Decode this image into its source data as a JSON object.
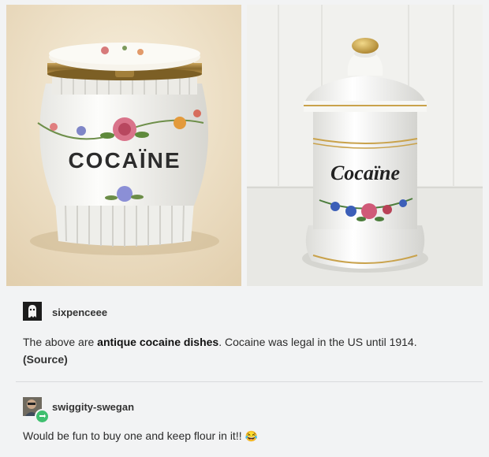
{
  "images": {
    "left_jar_label": "COCAÏNE",
    "right_jar_label": "Cocaïne"
  },
  "post1": {
    "username": "sixpenceee",
    "text_before": "The above are ",
    "text_bold": "antique cocaine dishes",
    "text_after": ". Cocaine was legal in the US until 1914.",
    "source_label": "(Source)"
  },
  "reply": {
    "username": "swiggity-swegan",
    "text": "Would be fun to buy one and keep flour in it!!",
    "emoji": "😂"
  },
  "colors": {
    "background": "#f2f3f4",
    "divider": "#d9dadc"
  }
}
